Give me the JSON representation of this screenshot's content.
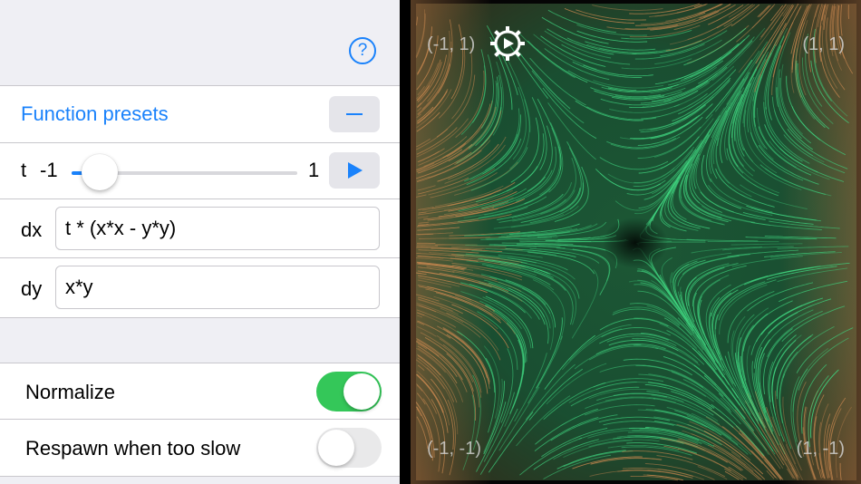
{
  "help": {
    "icon": "question-circle-icon",
    "label": "?"
  },
  "presets": {
    "label": "Function presets",
    "collapse_icon": "minus-icon"
  },
  "param": {
    "name": "t",
    "min_label": "-1",
    "max_label": "1",
    "value": -1,
    "slider_fraction": 0.1,
    "play_icon": "play-icon"
  },
  "equations": {
    "dx_label": "dx",
    "dx_value": "t * (x*x - y*y)",
    "dy_label": "dy",
    "dy_value": "x*y"
  },
  "options": {
    "normalize": {
      "label": "Normalize",
      "on": true
    },
    "respawn": {
      "label": "Respawn when too slow",
      "on": false
    }
  },
  "viewport": {
    "top_left": "(-1, 1)",
    "top_right": "(1, 1)",
    "bottom_left": "(-1, -1)",
    "bottom_right": "(1, -1)",
    "settings_icon": "gear-icon"
  },
  "colors": {
    "accent": "#1a82fb",
    "toggle_on": "#34c759",
    "field_green": "#3fd27e",
    "field_copper": "#c8874f"
  }
}
